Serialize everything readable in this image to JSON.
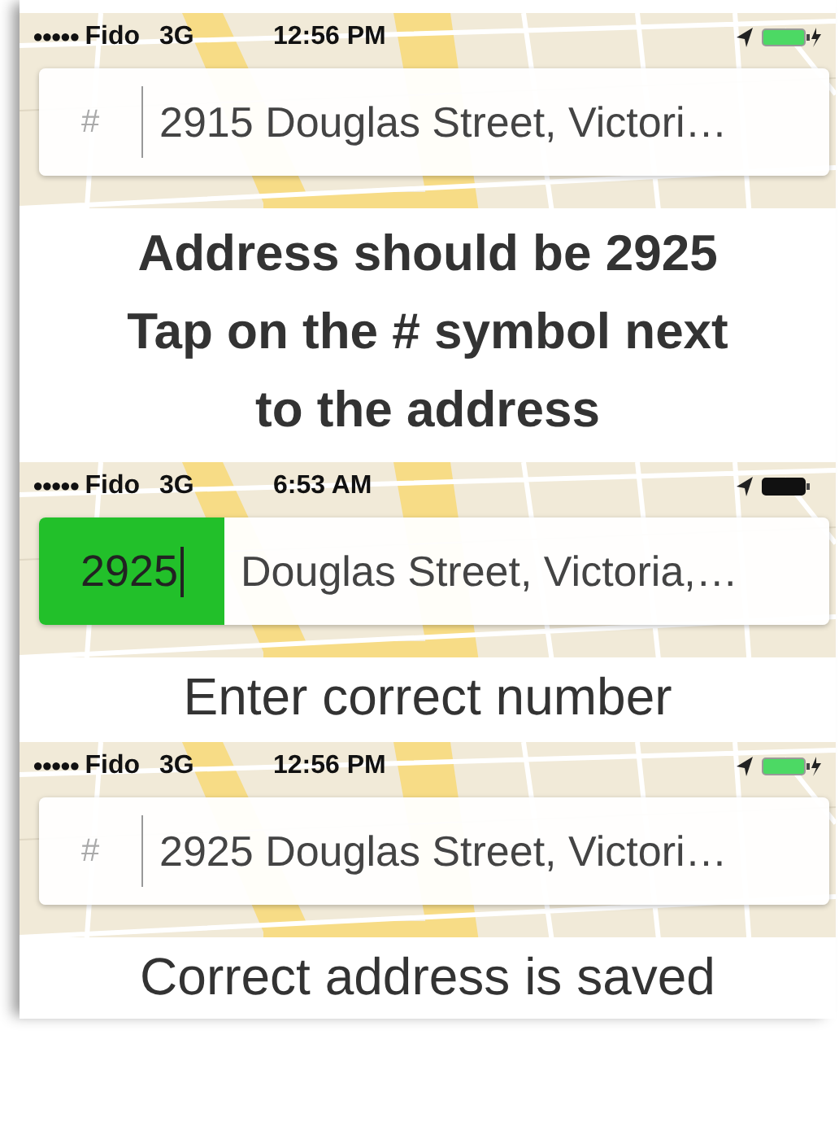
{
  "panels": [
    {
      "status_bar": {
        "signal": "●●●●●",
        "carrier": "Fido",
        "network": "3G",
        "time": "12:56 PM",
        "charging": true
      },
      "address_bar": {
        "number": {
          "kind": "hash",
          "text": "#"
        },
        "address": "2915 Douglas Street, Victori…"
      },
      "caption": {
        "bold": true,
        "lines": [
          "Address should be 2925",
          "Tap on the # symbol next",
          "to the address"
        ]
      }
    },
    {
      "status_bar": {
        "signal": "●●●●●",
        "carrier": "Fido",
        "network": "3G",
        "time": "6:53 AM",
        "charging": false
      },
      "address_bar": {
        "number": {
          "kind": "editing",
          "text": "2925"
        },
        "address": "Douglas Street, Victoria,…"
      },
      "caption": {
        "bold": false,
        "lines": [
          "Enter correct number"
        ]
      }
    },
    {
      "status_bar": {
        "signal": "●●●●●",
        "carrier": "Fido",
        "network": "3G",
        "time": "12:56 PM",
        "charging": true
      },
      "address_bar": {
        "number": {
          "kind": "hash",
          "text": "#"
        },
        "address": "2925 Douglas Street, Victori…"
      },
      "caption": {
        "bold": false,
        "lines": [
          "Correct address is saved"
        ]
      }
    }
  ]
}
